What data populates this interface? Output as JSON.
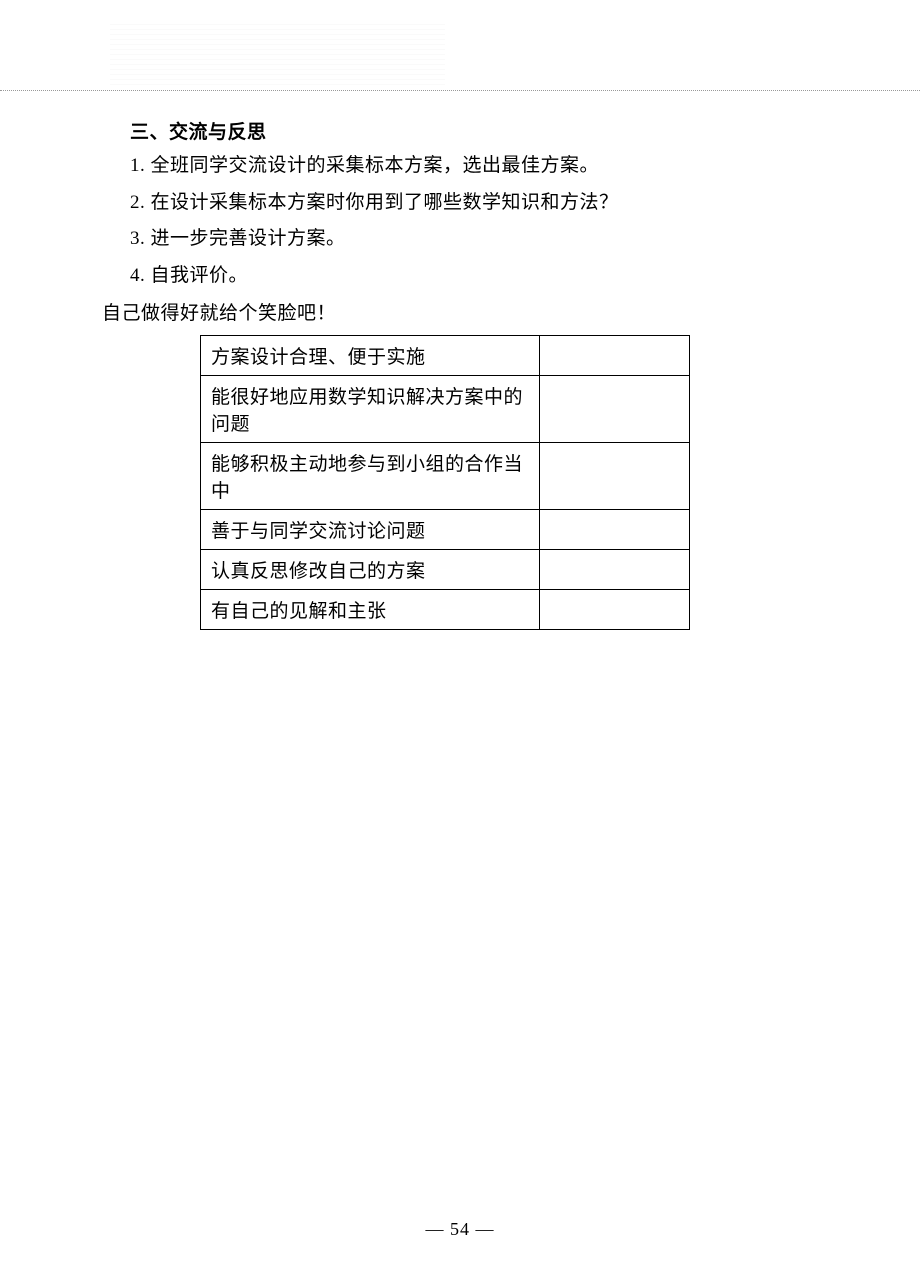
{
  "section": {
    "title": "三、交流与反思",
    "items": [
      "1. 全班同学交流设计的采集标本方案，选出最佳方案。",
      "2. 在设计采集标本方案时你用到了哪些数学知识和方法？",
      "3. 进一步完善设计方案。",
      "4. 自我评价。"
    ],
    "intro": "自己做得好就给个笑脸吧！"
  },
  "eval_table": {
    "rows": [
      {
        "criteria": "方案设计合理、便于实施",
        "response": ""
      },
      {
        "criteria": "能很好地应用数学知识解决方案中的问题",
        "response": ""
      },
      {
        "criteria": "能够积极主动地参与到小组的合作当中",
        "response": ""
      },
      {
        "criteria": "善于与同学交流讨论问题",
        "response": ""
      },
      {
        "criteria": "认真反思修改自己的方案",
        "response": ""
      },
      {
        "criteria": "有自己的见解和主张",
        "response": ""
      }
    ]
  },
  "page_number": "— 54 —"
}
